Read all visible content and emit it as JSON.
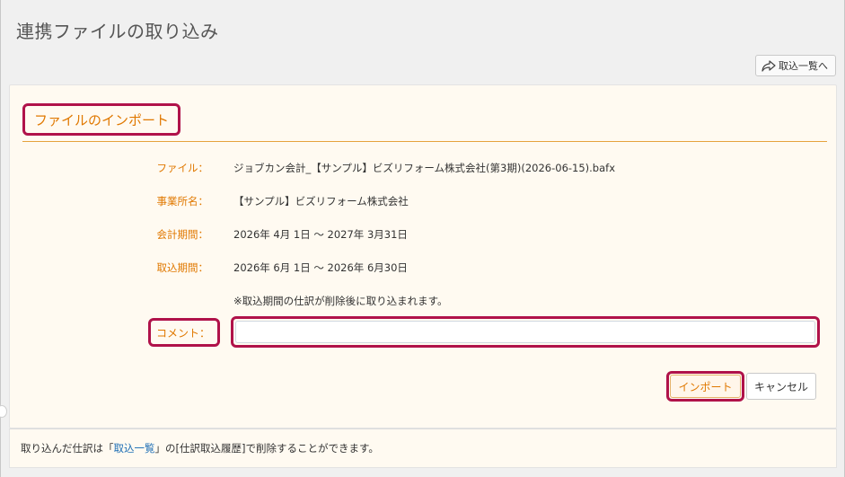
{
  "page": {
    "title": "連携ファイルの取り込み"
  },
  "header": {
    "back_label": "取込一覧へ",
    "back_icon": "share-arrow-icon"
  },
  "section": {
    "title": "ファイルのインポート"
  },
  "fields": {
    "file": {
      "label": "ファイル：",
      "value": "ジョブカン会計_【サンプル】ビズリフォーム株式会社(第3期)(2026-06-15).bafx"
    },
    "office": {
      "label": "事業所名：",
      "value": "【サンプル】ビズリフォーム株式会社"
    },
    "fiscal_period": {
      "label": "会計期間：",
      "value": "2026年 4月 1日 ～ 2027年 3月31日"
    },
    "import_period": {
      "label": "取込期間：",
      "value": "2026年 6月 1日 ～ 2026年 6月30日"
    },
    "note": "※取込期間の仕訳が削除後に取り込まれます。",
    "comment": {
      "label": "コメント：",
      "value": ""
    }
  },
  "buttons": {
    "import_label": "インポート",
    "cancel_label": "キャンセル"
  },
  "footer": {
    "text_before": "取り込んだ仕訳は「",
    "link_label": "取込一覧",
    "text_after": "」の[仕訳取込履歴]で削除することができます。"
  },
  "colors": {
    "accent_orange": "#e07800",
    "highlight_border": "#b0124a",
    "link_blue": "#1f6fb5",
    "panel_bg": "#fffaf1"
  }
}
